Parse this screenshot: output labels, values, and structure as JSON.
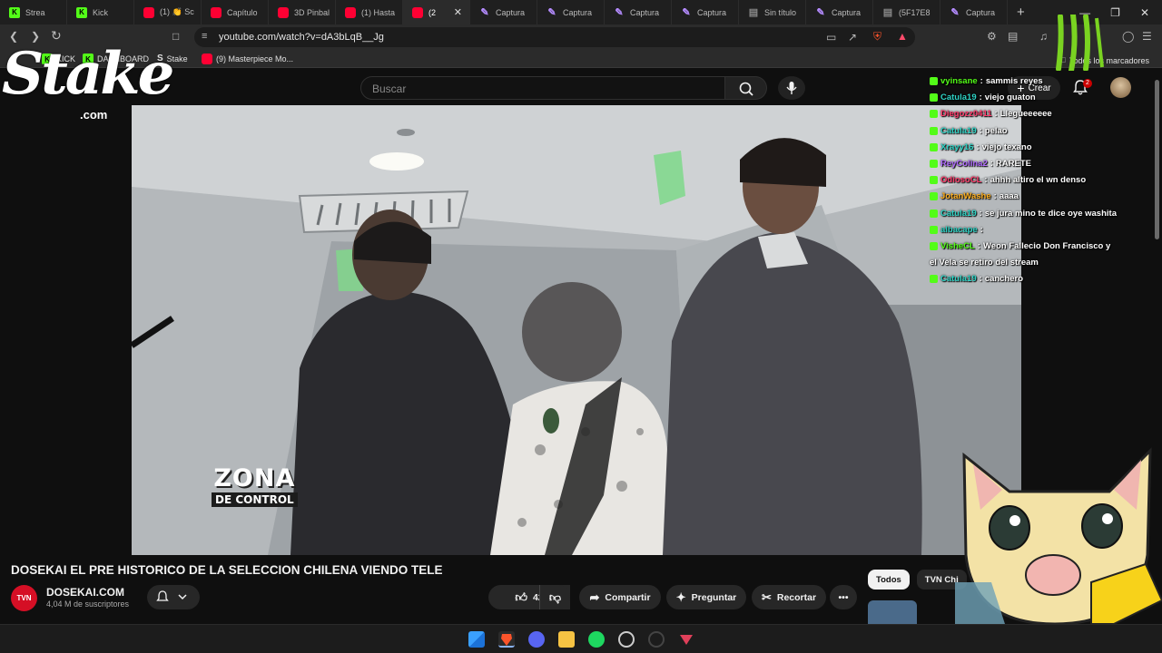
{
  "browser": {
    "tabs": [
      {
        "label": "Strea",
        "favicon": "kick"
      },
      {
        "label": "Kick",
        "favicon": "kick"
      },
      {
        "label": "(1) 👏 Sc",
        "favicon": "youtube"
      },
      {
        "label": "Capítulo",
        "favicon": "youtube"
      },
      {
        "label": "3D Pinbal",
        "favicon": "youtube"
      },
      {
        "label": "(1) Hasta",
        "favicon": "youtube"
      },
      {
        "label": "(2",
        "favicon": "youtube",
        "active": true
      },
      {
        "label": "Captura",
        "favicon": "pen"
      },
      {
        "label": "Captura",
        "favicon": "pen"
      },
      {
        "label": "Captura",
        "favicon": "pen"
      },
      {
        "label": "Captura",
        "favicon": "pen"
      },
      {
        "label": "Sin título",
        "favicon": "doc"
      },
      {
        "label": "Captura",
        "favicon": "pen"
      },
      {
        "label": "(5F17E8",
        "favicon": "doc"
      },
      {
        "label": "Captura",
        "favicon": "pen"
      }
    ],
    "new_tab_symbol": "+",
    "url": "youtube.com/watch?v=dA3bLqB__Jg",
    "bookmarks": [
      {
        "label": "KICK",
        "favicon": "kick"
      },
      {
        "label": "DASHBOARD",
        "favicon": "kick"
      },
      {
        "label": "Stake",
        "favicon": "stake"
      },
      {
        "label": "(9) Masterpiece Mo...",
        "favicon": "youtube"
      }
    ],
    "all_bookmarks_label": "Todos los marcadores"
  },
  "youtube": {
    "search_placeholder": "Buscar",
    "create_label": "Crear",
    "notification_count": "2",
    "video": {
      "overlay_title_line1": "ZONA",
      "overlay_title_line2": "DE CONTROL",
      "title": "DOSEKAI EL PRE HISTORICO DE LA SELECCION CHILENA VIENDO TELE",
      "channel_logo_text": "TVN",
      "channel_name": "DOSEKAI.COM",
      "subscribers": "4,04 M de suscriptores",
      "likes": "42",
      "share_label": "Compartir",
      "ask_label": "Preguntar",
      "clip_label": "Recortar"
    },
    "chips": [
      "Todos",
      "TVN Chi"
    ]
  },
  "stream_overlay": {
    "stake_logo": "Stake",
    "stake_domain": ".com",
    "chat": [
      {
        "user": "vyinsane",
        "text": "sammis reyes",
        "color": "#53fc18"
      },
      {
        "user": "Catula19",
        "text": "viejo guaton",
        "color": "#2fd4c6"
      },
      {
        "user": "Diegozz0411",
        "text": "Llegueeeeee",
        "color": "#ff3b6b"
      },
      {
        "user": "Catula19",
        "text": "pelao",
        "color": "#2fd4c6"
      },
      {
        "user": "Xrayy16",
        "text": "viejo texano",
        "color": "#2fd4c6"
      },
      {
        "user": "ReyColina2",
        "text": "RARETE",
        "color": "#b06bff"
      },
      {
        "user": "OdiosoCL",
        "text": "ahhh altiro el wn denso",
        "color": "#ff3b6b"
      },
      {
        "user": "JotanWashe",
        "text": "aaaa",
        "color": "#ffb020"
      },
      {
        "user": "Catula19",
        "text": "se jura mino te dice oye washita",
        "color": "#2fd4c6"
      },
      {
        "user": "albacape",
        "text": "",
        "color": "#2fd4c6"
      },
      {
        "user": "VisheCL",
        "text": "Weon Fallecio Don Francisco y",
        "color": "#53fc18"
      },
      {
        "user": "",
        "text": "el Vela se retiro del stream",
        "color": "#ffffff"
      },
      {
        "user": "Catula19",
        "text": "canchero",
        "color": "#2fd4c6"
      }
    ]
  },
  "colors": {
    "youtube_red": "#ff0033",
    "kick_green": "#53fc18",
    "background": "#0f0f0f"
  }
}
